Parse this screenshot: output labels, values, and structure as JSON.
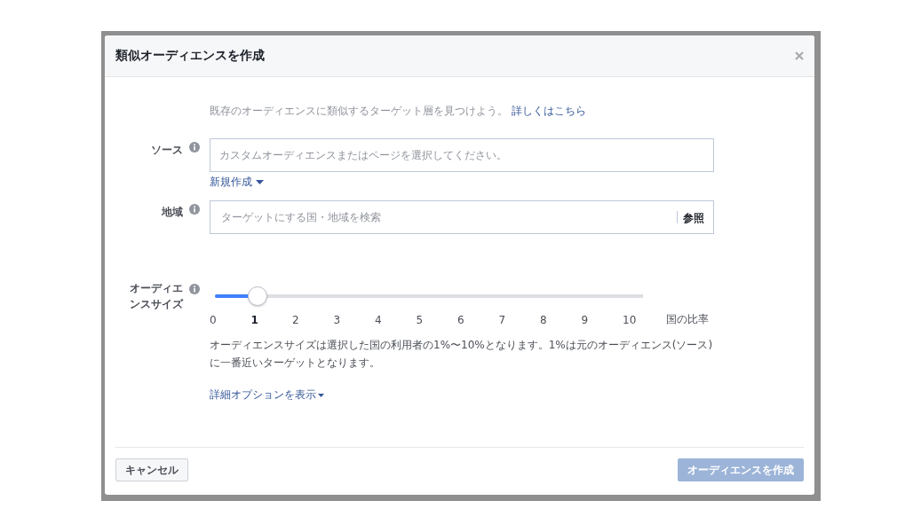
{
  "dialog": {
    "title": "類似オーディエンスを作成"
  },
  "intro": {
    "text": "既存のオーディエンスに類似するターゲット層を見つけよう。",
    "link": "詳しくはこちら"
  },
  "source": {
    "label": "ソース",
    "placeholder": "カスタムオーディエンスまたはページを選択してください。",
    "create_new": "新規作成"
  },
  "region": {
    "label": "地域",
    "placeholder": "ターゲットにする国・地域を検索",
    "browse": "参照"
  },
  "audience_size": {
    "label": "オーディエンスサイズ",
    "level": 0.1,
    "ticks": [
      {
        "label": "0",
        "selected": false
      },
      {
        "label": "1",
        "selected": true
      },
      {
        "label": "2",
        "selected": false
      },
      {
        "label": "3",
        "selected": false
      },
      {
        "label": "4",
        "selected": false
      },
      {
        "label": "5",
        "selected": false
      },
      {
        "label": "6",
        "selected": false
      },
      {
        "label": "7",
        "selected": false
      },
      {
        "label": "8",
        "selected": false
      },
      {
        "label": "9",
        "selected": false
      },
      {
        "label": "10",
        "selected": false
      }
    ],
    "unit": "国の比率",
    "note": "オーディエンスサイズは選択した国の利用者の1%〜10%となります。1%は元のオーディエンス(ソース)に一番近いターゲットとなります。"
  },
  "advanced": "詳細オプションを表示",
  "buttons": {
    "cancel": "キャンセル",
    "create": {
      "label": "オーディエンスを作成",
      "disabled": true
    }
  }
}
